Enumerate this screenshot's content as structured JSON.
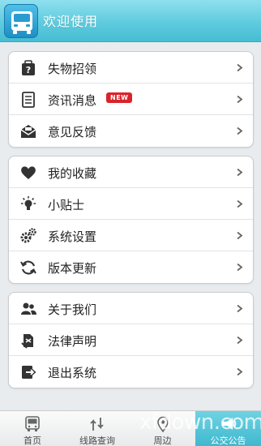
{
  "header": {
    "title": "欢迎使用"
  },
  "groups": [
    {
      "items": [
        {
          "label": "失物招领",
          "icon": "lost-found-icon"
        },
        {
          "label": "资讯消息",
          "icon": "news-document-icon",
          "badge": "NEW"
        },
        {
          "label": "意见反馈",
          "icon": "feedback-mail-icon"
        }
      ]
    },
    {
      "items": [
        {
          "label": "我的收藏",
          "icon": "heart-icon"
        },
        {
          "label": "小贴士",
          "icon": "lightbulb-icon"
        },
        {
          "label": "系统设置",
          "icon": "gears-icon"
        },
        {
          "label": "版本更新",
          "icon": "refresh-icon"
        }
      ]
    },
    {
      "items": [
        {
          "label": "关于我们",
          "icon": "users-icon"
        },
        {
          "label": "法律声明",
          "icon": "legal-icon"
        },
        {
          "label": "退出系统",
          "icon": "exit-icon"
        }
      ]
    }
  ],
  "tabs": [
    {
      "label": "首页",
      "icon": "bus-icon"
    },
    {
      "label": "线路查询",
      "icon": "route-icon"
    },
    {
      "label": "周边",
      "icon": "location-icon"
    },
    {
      "label": "公交公告",
      "icon": "announcement-icon",
      "active": true
    }
  ],
  "watermark": "xfdown.com",
  "colors": {
    "header": "#5fcbde",
    "active_tab": "#3fb7cd",
    "badge": "#d9242b"
  }
}
